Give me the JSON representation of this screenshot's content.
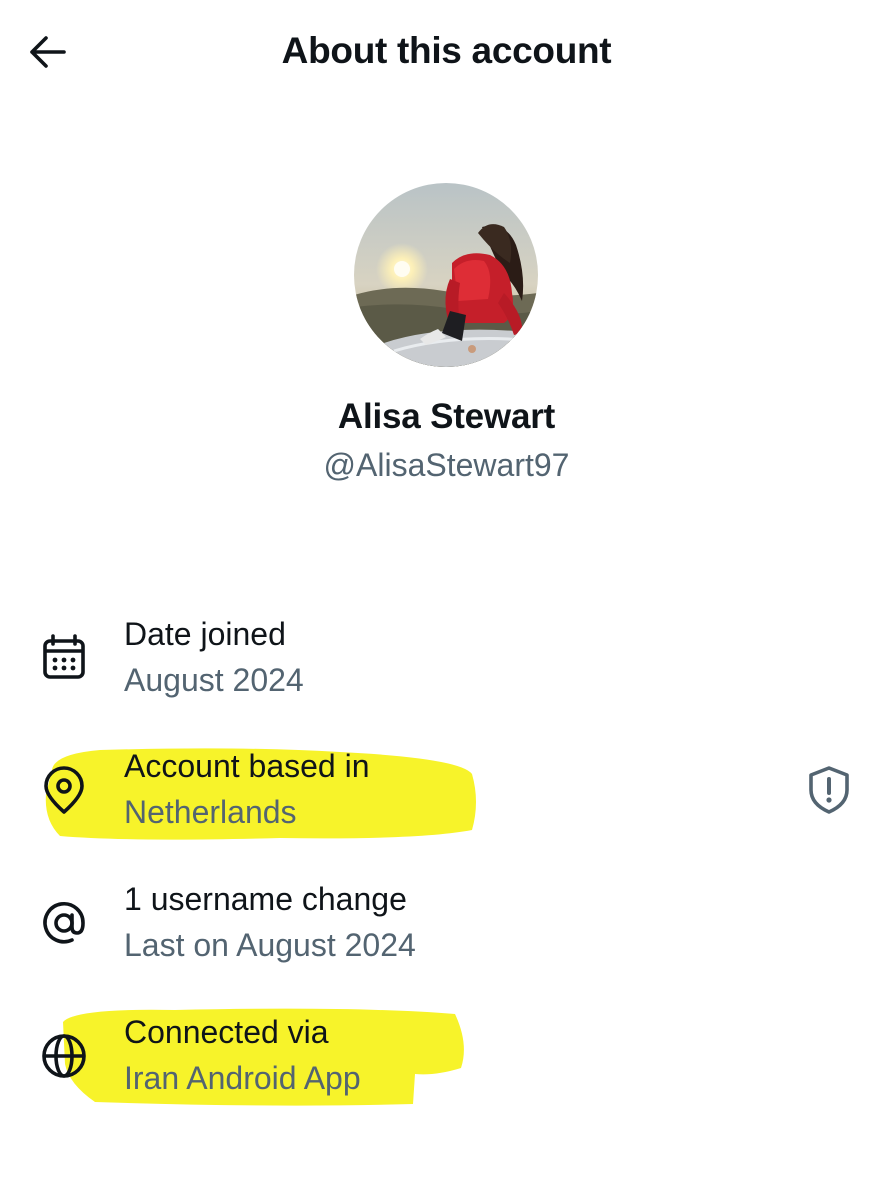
{
  "header": {
    "title": "About this account",
    "back_icon": "arrow-left-icon"
  },
  "profile": {
    "display_name": "Alisa Stewart",
    "handle": "@AlisaStewart97"
  },
  "rows": [
    {
      "icon": "calendar-icon",
      "label": "Date joined",
      "value": "August 2024"
    },
    {
      "icon": "location-pin-icon",
      "label": "Account based in",
      "value": "Netherlands",
      "trailing_icon": "shield-alert-icon"
    },
    {
      "icon": "at-sign-icon",
      "label": "1 username change",
      "value": "Last on August 2024"
    },
    {
      "icon": "globe-icon",
      "label": "Connected via",
      "value": "Iran Android App"
    }
  ],
  "colors": {
    "text_primary": "#0f1419",
    "text_secondary": "#536471",
    "highlight": "#f7f32a"
  }
}
